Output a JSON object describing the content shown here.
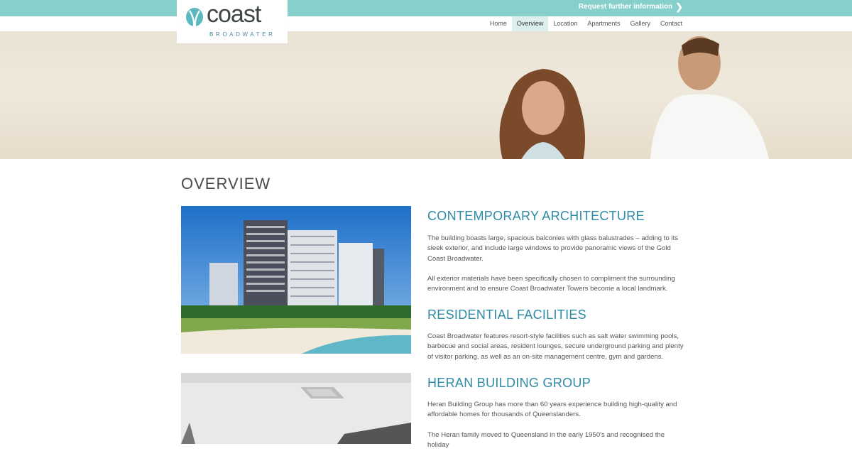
{
  "topbar": {
    "request_label": "Request further information"
  },
  "logo": {
    "name": "coast",
    "sub": "BROADWATER"
  },
  "nav": {
    "items": [
      {
        "label": "Home"
      },
      {
        "label": "Overview"
      },
      {
        "label": "Location"
      },
      {
        "label": "Apartments"
      },
      {
        "label": "Gallery"
      },
      {
        "label": "Contact"
      }
    ],
    "active": "Overview"
  },
  "page": {
    "title": "OVERVIEW"
  },
  "sections": [
    {
      "heading": "CONTEMPORARY ARCHITECTURE",
      "paragraphs": [
        "The building boasts large, spacious balconies with glass balustrades – adding to its sleek exterior, and include large windows to provide panoramic views of the Gold Coast Broadwater.",
        "All exterior materials have been specifically chosen to compliment the surrounding environment and to ensure Coast Broadwater Towers become a local landmark."
      ]
    },
    {
      "heading": "RESIDENTIAL FACILITIES",
      "paragraphs": [
        "Coast Broadwater features resort-style facilities such as salt water swimming pools, barbecue and social areas, resident lounges, secure underground parking and plenty of visitor parking, as well as an on-site management centre, gym and gardens."
      ]
    },
    {
      "heading": "HERAN BUILDING GROUP",
      "paragraphs": [
        "Heran Building Group has more than 60 years experience building high-quality and affordable homes for thousands of Queenslanders.",
        "The Heran family moved to Queensland in the early 1950's and recognised the holiday"
      ]
    }
  ],
  "colors": {
    "topbar": "#86cfcb",
    "heading": "#2e8ba6",
    "nav_active_bg": "#dcefee"
  },
  "icons": {
    "request_arrow": "chevron-right-icon",
    "logo_mark": "leaf-icon"
  }
}
